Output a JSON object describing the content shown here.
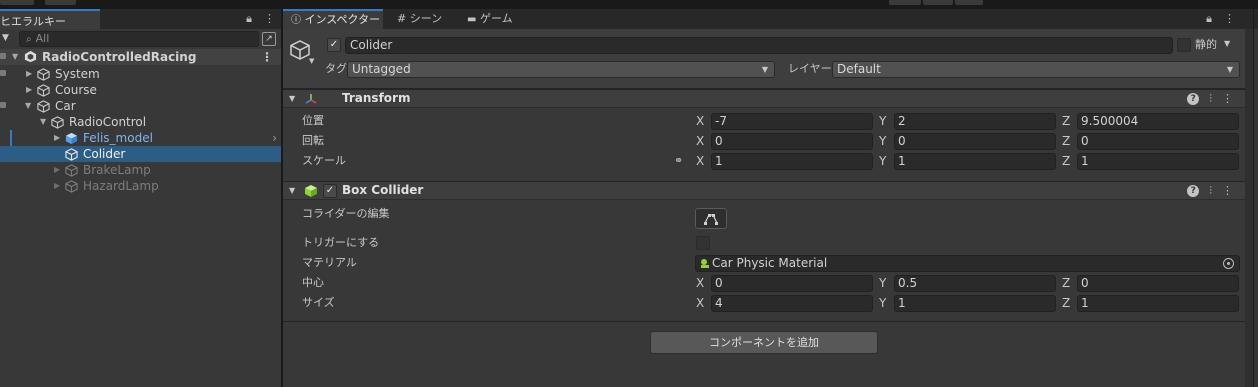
{
  "hierarchy": {
    "tab_label": "ヒエラルキー",
    "search_placeholder": "All",
    "scene": "RadioControlledRacing",
    "items": [
      {
        "label": "System"
      },
      {
        "label": "Course"
      },
      {
        "label": "Car"
      },
      {
        "label": "RadioControl"
      },
      {
        "label": "Felis_model"
      },
      {
        "label": "Colider"
      },
      {
        "label": "BrakeLamp"
      },
      {
        "label": "HazardLamp"
      }
    ]
  },
  "inspector": {
    "tabs": [
      {
        "label": "インスペクター"
      },
      {
        "label": "シーン"
      },
      {
        "label": "ゲーム"
      }
    ],
    "object": {
      "name": "Colider",
      "static_label": "静的",
      "tag_label": "タグ",
      "tag_value": "Untagged",
      "layer_label": "レイヤー",
      "layer_value": "Default"
    },
    "transform": {
      "title": "Transform",
      "position_label": "位置",
      "rotation_label": "回転",
      "scale_label": "スケール",
      "position": {
        "x": "-7",
        "y": "2",
        "z": "9.500004"
      },
      "rotation": {
        "x": "0",
        "y": "0",
        "z": "0"
      },
      "scale": {
        "x": "1",
        "y": "1",
        "z": "1"
      }
    },
    "box_collider": {
      "title": "Box Collider",
      "edit_label": "コライダーの編集",
      "trigger_label": "トリガーにする",
      "material_label": "マテリアル",
      "material_value": "Car Physic Material",
      "center_label": "中心",
      "size_label": "サイズ",
      "center": {
        "x": "0",
        "y": "0.5",
        "z": "0"
      },
      "size": {
        "x": "4",
        "y": "1",
        "z": "1"
      }
    },
    "add_component": "コンポーネントを追加"
  },
  "axes": {
    "x": "X",
    "y": "Y",
    "z": "Z"
  },
  "colors": {
    "selection": "#2c5d87",
    "accent_tab": "#3a79bb",
    "prefab_blue": "#7eb4f0",
    "transform_icon": "#e2463b",
    "collider_icon": "#8fd23a"
  },
  "icons": [
    "lock-icon",
    "kebab-menu-icon",
    "search-icon",
    "gameobject-cube-icon",
    "prefab-cube-icon",
    "scene-unity-icon",
    "transform-axes-icon",
    "box-collider-icon",
    "help-icon",
    "preset-icon",
    "link-icon",
    "edit-collider-icon",
    "object-picker-icon",
    "physic-material-icon",
    "grid-icon",
    "gamepad-icon",
    "info-icon"
  ]
}
